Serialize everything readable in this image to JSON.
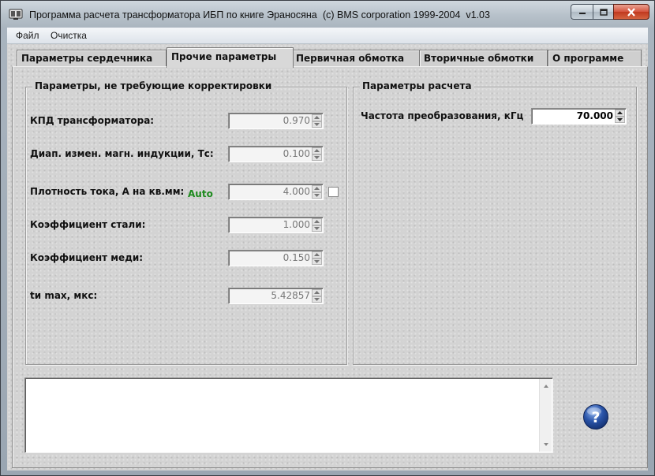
{
  "window": {
    "title": "Программа расчета трансформатора ИБП по книге Эраносяна",
    "copyright": "(c) BMS corporation 1999-2004  v1.03"
  },
  "menu": [
    "Файл",
    "Очистка"
  ],
  "tabs": [
    {
      "label": "Параметры сердечника",
      "active": false
    },
    {
      "label": "Прочие параметры",
      "active": true
    },
    {
      "label": "Первичная обмотка",
      "active": false
    },
    {
      "label": "Вторичные обмотки",
      "active": false
    },
    {
      "label": "О программе",
      "active": false
    }
  ],
  "left_group": {
    "title": "Параметры, не требующие корректировки",
    "fields": [
      {
        "label": "КПД трансформатора:",
        "value": "0.970"
      },
      {
        "label": "Диап. измен. магн. индукции, Тс:",
        "value": "0.100"
      },
      {
        "label": "Плотность тока, А на кв.мм:",
        "value": "4.000"
      },
      {
        "label": "Коэффициент стали:",
        "value": "1.000"
      },
      {
        "label": "Коэффициент меди:",
        "value": "0.150"
      },
      {
        "label": "tи max, мкс:",
        "value": "5.42857"
      }
    ],
    "auto_label": "Auto",
    "auto_checked": false
  },
  "right_group": {
    "title": "Параметры расчета",
    "fields": [
      {
        "label": "Частота  преобразования, кГц",
        "value": "70.000"
      }
    ]
  },
  "log_text": "",
  "icons": {
    "app": "transformer-app-icon",
    "help": "help-icon"
  },
  "colors": {
    "auto_label": "#1d8a1d",
    "help_button": "#2a54a8",
    "close_button": "#c8432a"
  }
}
